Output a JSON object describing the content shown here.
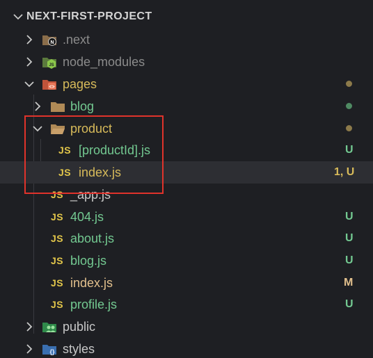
{
  "explorer": {
    "project_title": "NEXT-FIRST-PROJECT",
    "colors": {
      "untracked": "#73c991",
      "modified": "#e2c08d",
      "ignored": "#8b8b8b",
      "highlight_box": "#e0332b"
    },
    "items": [
      {
        "label": ".next",
        "icon": "next-folder-icon",
        "state": "collapsed",
        "status": ""
      },
      {
        "label": "node_modules",
        "icon": "node-folder-icon",
        "state": "collapsed",
        "status": ""
      },
      {
        "label": "pages",
        "icon": "pages-folder-icon",
        "state": "expanded",
        "status": ""
      },
      {
        "label": "blog",
        "icon": "folder-icon",
        "state": "collapsed",
        "status": ""
      },
      {
        "label": "product",
        "icon": "folder-open-icon",
        "state": "expanded",
        "status": ""
      },
      {
        "label": "[productId].js",
        "icon": "js-icon",
        "status": "U"
      },
      {
        "label": "index.js",
        "icon": "js-icon",
        "status": "1, U"
      },
      {
        "label": "_app.js",
        "icon": "js-icon",
        "status": ""
      },
      {
        "label": "404.js",
        "icon": "js-icon",
        "status": "U"
      },
      {
        "label": "about.js",
        "icon": "js-icon",
        "status": "U"
      },
      {
        "label": "blog.js",
        "icon": "js-icon",
        "status": "U"
      },
      {
        "label": "index.js",
        "icon": "js-icon",
        "status": "M"
      },
      {
        "label": "profile.js",
        "icon": "js-icon",
        "status": "U"
      },
      {
        "label": "public",
        "icon": "public-folder-icon",
        "state": "collapsed",
        "status": ""
      },
      {
        "label": "styles",
        "icon": "styles-folder-icon",
        "state": "collapsed",
        "status": ""
      }
    ],
    "js_badge": "JS"
  }
}
